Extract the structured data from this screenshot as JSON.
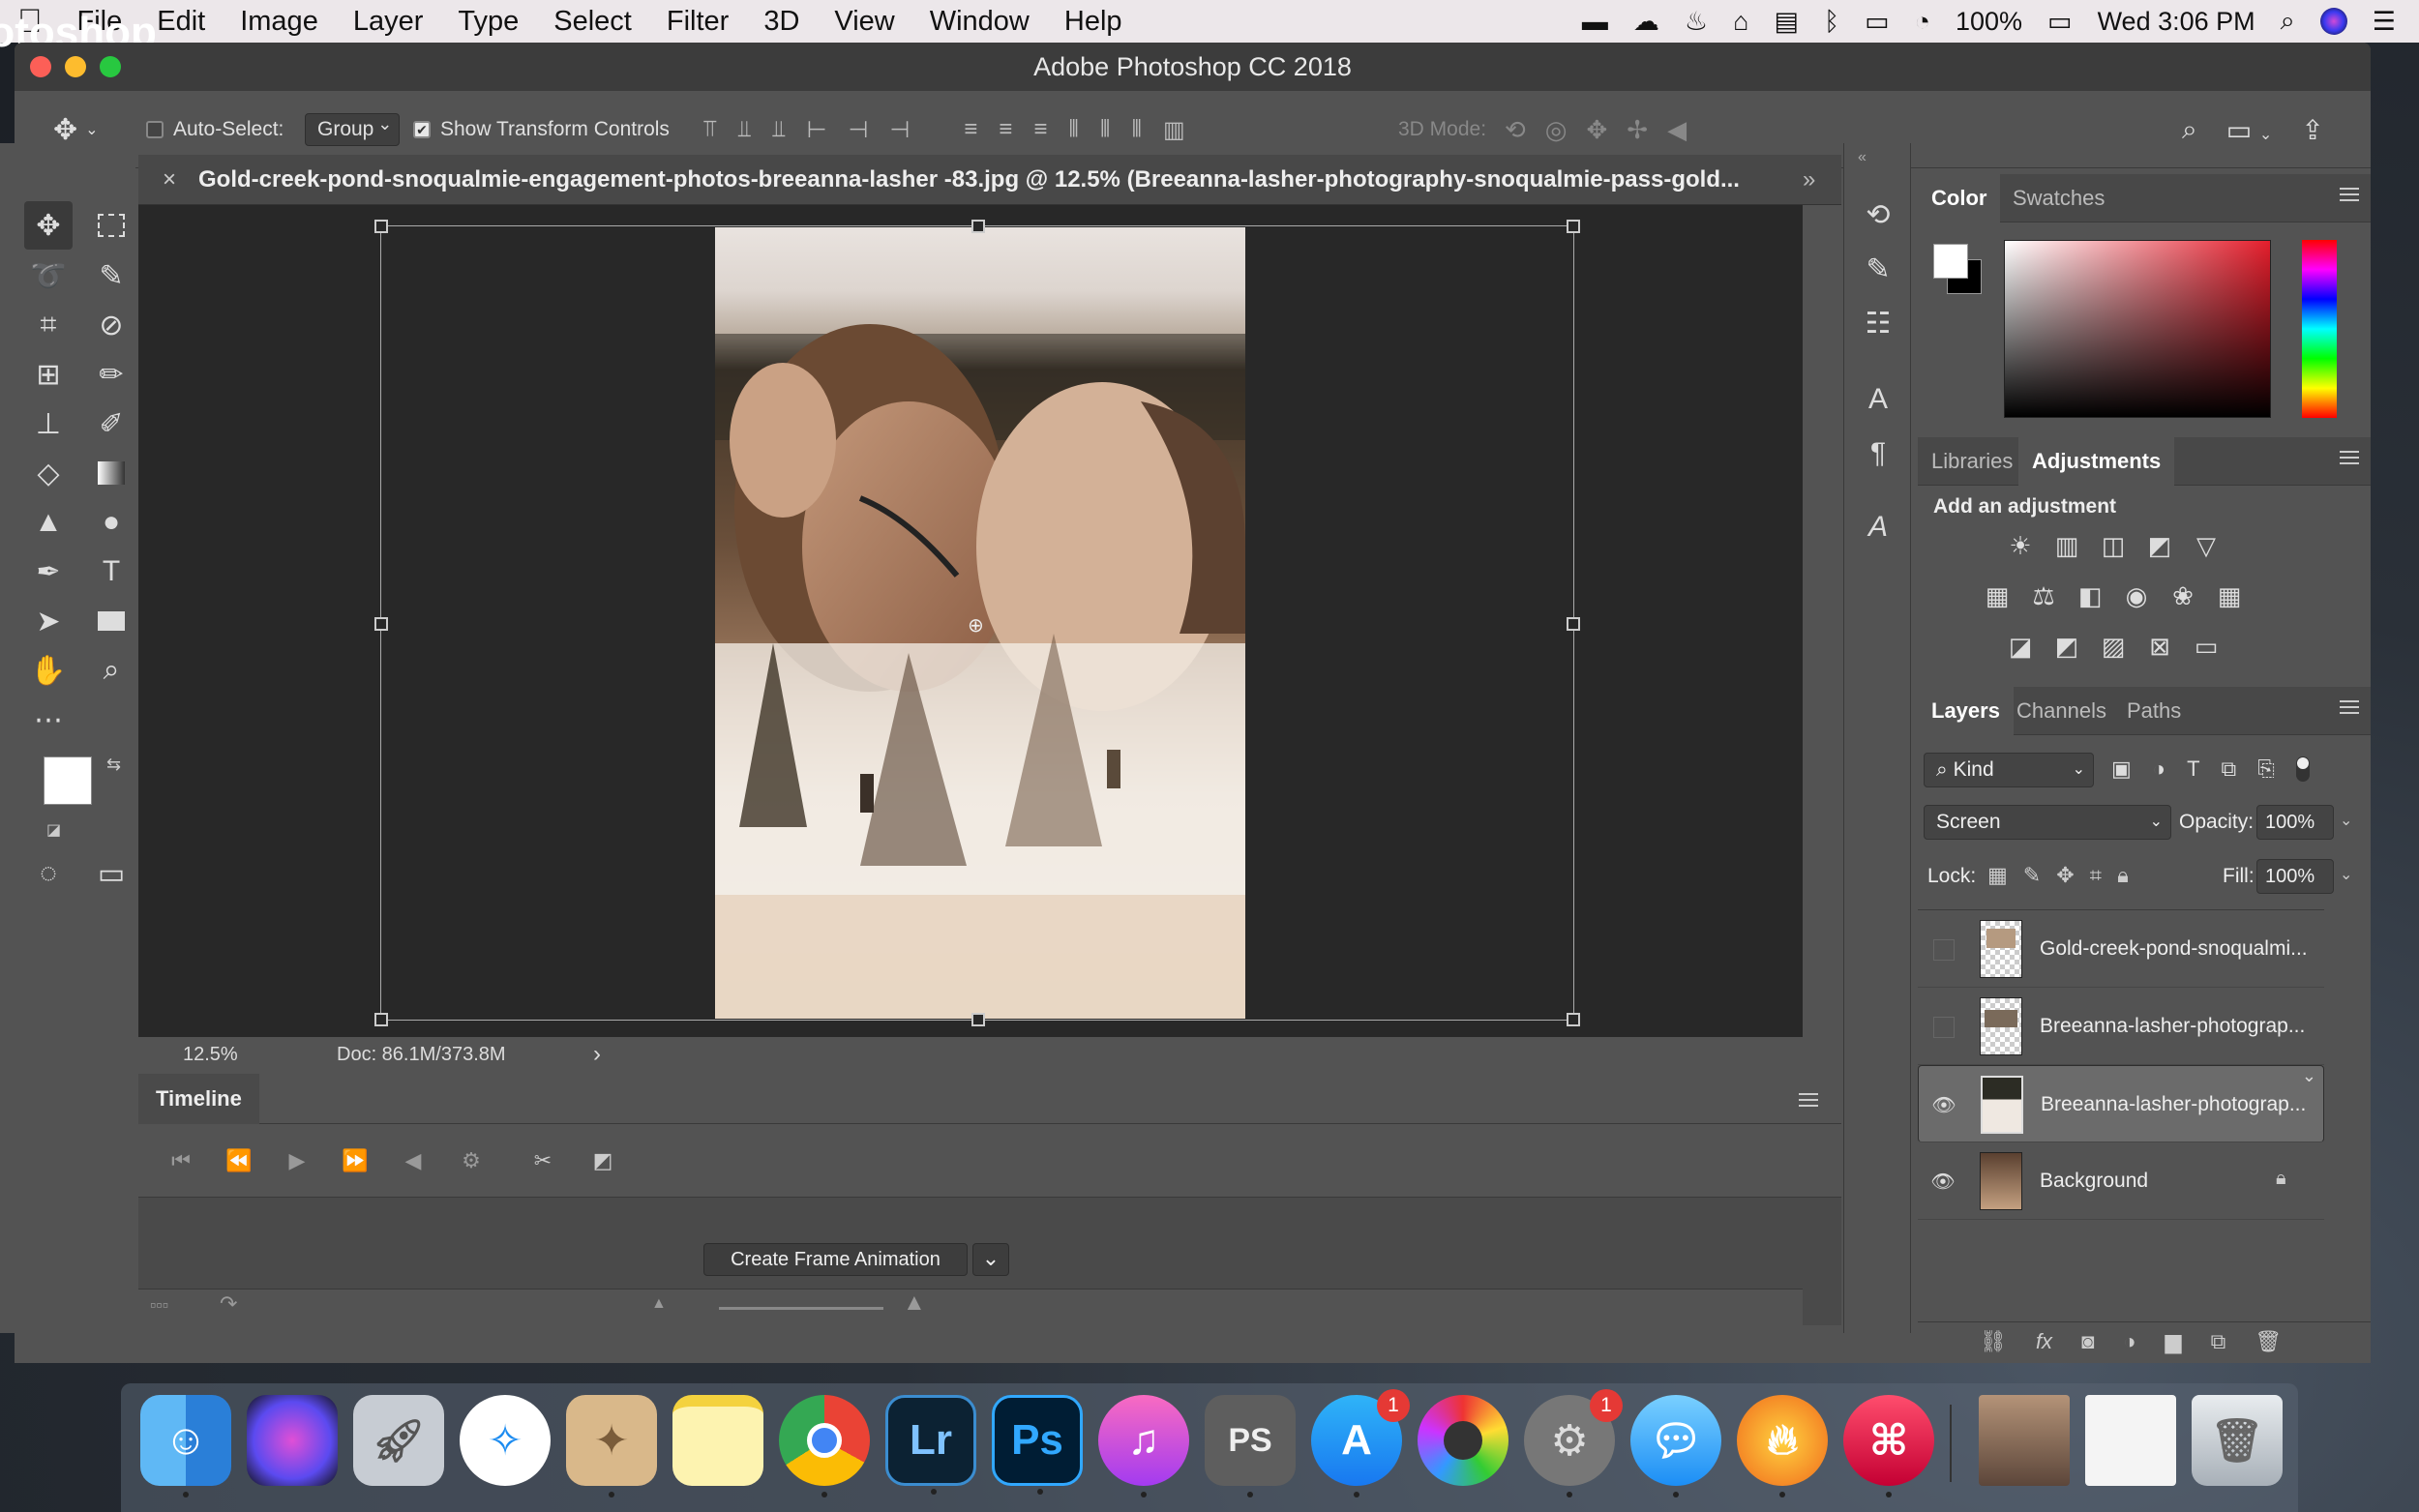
{
  "menubar": {
    "app_name": "Photoshop CC",
    "menus": [
      "File",
      "Edit",
      "Image",
      "Layer",
      "Type",
      "Select",
      "Filter",
      "3D",
      "View",
      "Window",
      "Help"
    ],
    "battery": "100%",
    "clock": "Wed 3:06 PM"
  },
  "window": {
    "title": "Adobe Photoshop CC 2018"
  },
  "options": {
    "auto_select_label": "Auto-Select:",
    "auto_select_value": "Group",
    "show_transform_label": "Show Transform Controls",
    "mode_3d_label": "3D Mode:"
  },
  "document": {
    "tab_title": "Gold-creek-pond-snoqualmie-engagement-photos-breeanna-lasher -83.jpg @ 12.5% (Breeanna-lasher-photography-snoqualmie-pass-gold...",
    "zoom": "12.5%",
    "doc_size": "Doc: 86.1M/373.8M"
  },
  "timeline": {
    "tab": "Timeline",
    "create_button": "Create Frame Animation"
  },
  "color_panel": {
    "tabs": [
      "Color",
      "Swatches"
    ],
    "active": "Color"
  },
  "adjustments_panel": {
    "tabs": [
      "Libraries",
      "Adjustments"
    ],
    "active": "Adjustments",
    "heading": "Add an adjustment"
  },
  "layers_panel": {
    "tabs": [
      "Layers",
      "Channels",
      "Paths"
    ],
    "active": "Layers",
    "filter_kind": "Kind",
    "blend_mode": "Screen",
    "opacity_label": "Opacity:",
    "opacity_value": "100%",
    "lock_label": "Lock:",
    "fill_label": "Fill:",
    "fill_value": "100%",
    "layers": [
      {
        "name": "Gold-creek-pond-snoqualmi...",
        "visible": false,
        "selected": false
      },
      {
        "name": "Breeanna-lasher-photograp...",
        "visible": false,
        "selected": false
      },
      {
        "name": "Breeanna-lasher-photograp...",
        "visible": true,
        "selected": true
      },
      {
        "name": "Background",
        "visible": true,
        "selected": false,
        "locked": true
      }
    ]
  },
  "dock": {
    "apps": [
      "Finder",
      "Siri",
      "Launchpad",
      "Safari",
      "Preview",
      "Notes",
      "Chrome",
      "Lightroom",
      "Photoshop",
      "iTunes",
      "Photoshop Script",
      "App Store",
      "Color Sync",
      "System Preferences",
      "Messages",
      "Hot App",
      "Magnet"
    ],
    "badges": {
      "app_store": "1",
      "system_prefs": "1"
    },
    "lr_label": "Lr",
    "ps_label": "Ps"
  }
}
